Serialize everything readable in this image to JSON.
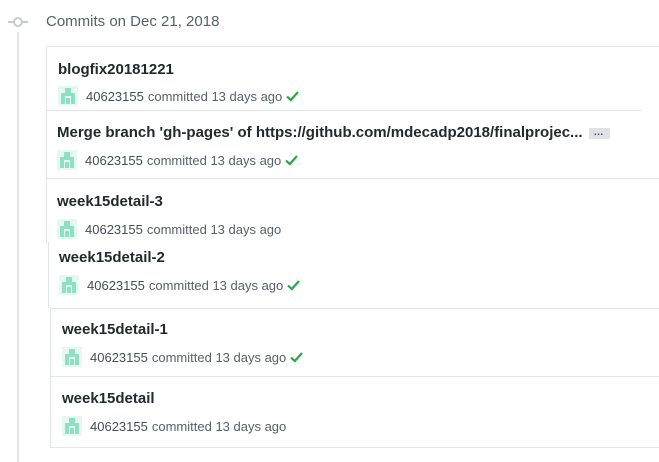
{
  "group": {
    "title": "Commits on Dec 21, 2018"
  },
  "commits": [
    {
      "message": "blogfix20181221",
      "author": "40623155",
      "action": "committed",
      "time": "13 days ago",
      "status": "success"
    },
    {
      "message": "Merge branch 'gh-pages' of https://github.com/mdecadp2018/finalprojec...",
      "author": "40623155",
      "action": "committed",
      "time": "13 days ago",
      "status": "success",
      "ellipsis": "…"
    },
    {
      "message": "week15detail-3",
      "author": "40623155",
      "action": "committed",
      "time": "13 days ago",
      "status": "none"
    },
    {
      "message": "week15detail-2",
      "author": "40623155",
      "action": "committed",
      "time": "13 days ago",
      "status": "success"
    },
    {
      "message": "week15detail-1",
      "author": "40623155",
      "action": "committed",
      "time": "13 days ago",
      "status": "success"
    },
    {
      "message": "week15detail",
      "author": "40623155",
      "action": "committed",
      "time": "13 days ago",
      "status": "none"
    }
  ],
  "colors": {
    "success": "#28a745",
    "avatar": "#8ee0c4",
    "border": "#e1e4e8"
  }
}
